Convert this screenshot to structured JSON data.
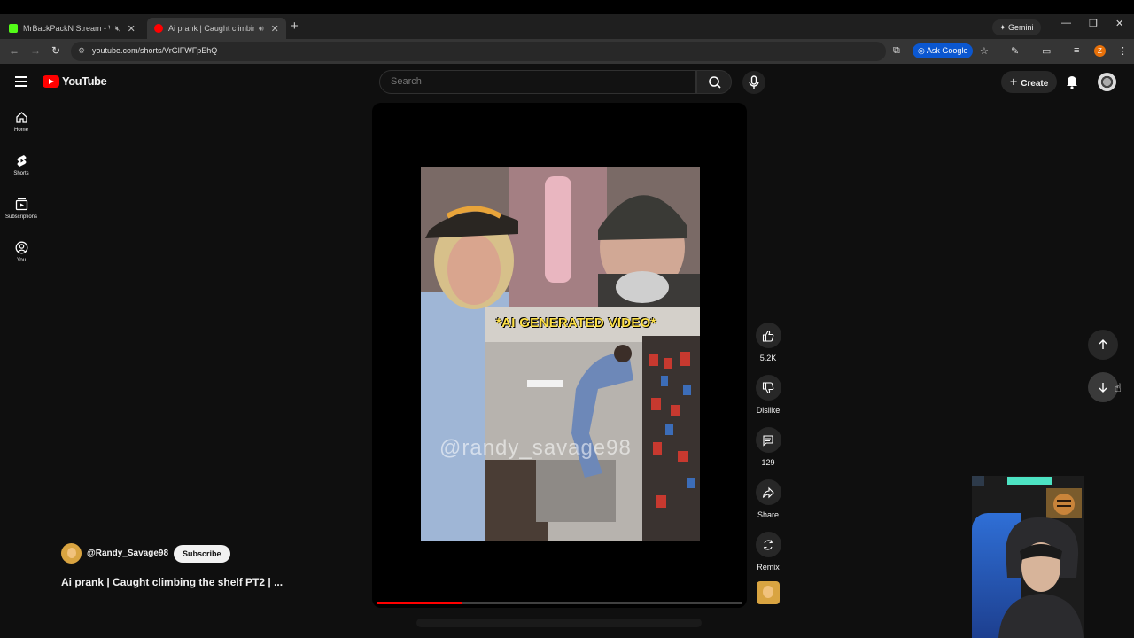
{
  "browser": {
    "tabs": [
      {
        "title": "MrBackPackN Stream - Wat",
        "favicon_color": "#53fc18",
        "active": false
      },
      {
        "title": "Ai prank | Caught climbing",
        "favicon_color": "#ff0000",
        "active": true
      }
    ],
    "gemini_label": "Gemini",
    "url": "youtube.com/shorts/VrGlFWFpEhQ",
    "ask_google_label": "Ask Google",
    "profile_initial": "Z"
  },
  "header": {
    "logo_text": "YouTube",
    "search_placeholder": "Search",
    "create_label": "Create"
  },
  "sidebar": {
    "items": [
      {
        "label": "Home"
      },
      {
        "label": "Shorts"
      },
      {
        "label": "Subscriptions"
      },
      {
        "label": "You"
      }
    ]
  },
  "video": {
    "overlay_banner": "*AI GENERATED VIDEO*",
    "watermark": "@randy_savage98",
    "progress_fraction": 0.23
  },
  "channel": {
    "handle": "@Randy_Savage98",
    "subscribe_label": "Subscribe",
    "title": "Ai prank | Caught climbing the shelf PT2 | ..."
  },
  "actions": {
    "like_count": "5.2K",
    "dislike_label": "Dislike",
    "comment_count": "129",
    "share_label": "Share",
    "remix_label": "Remix"
  },
  "colors": {
    "accent_red": "#ff0000",
    "banner_yellow": "#fde047",
    "ask_google_blue": "#0b57d0"
  }
}
